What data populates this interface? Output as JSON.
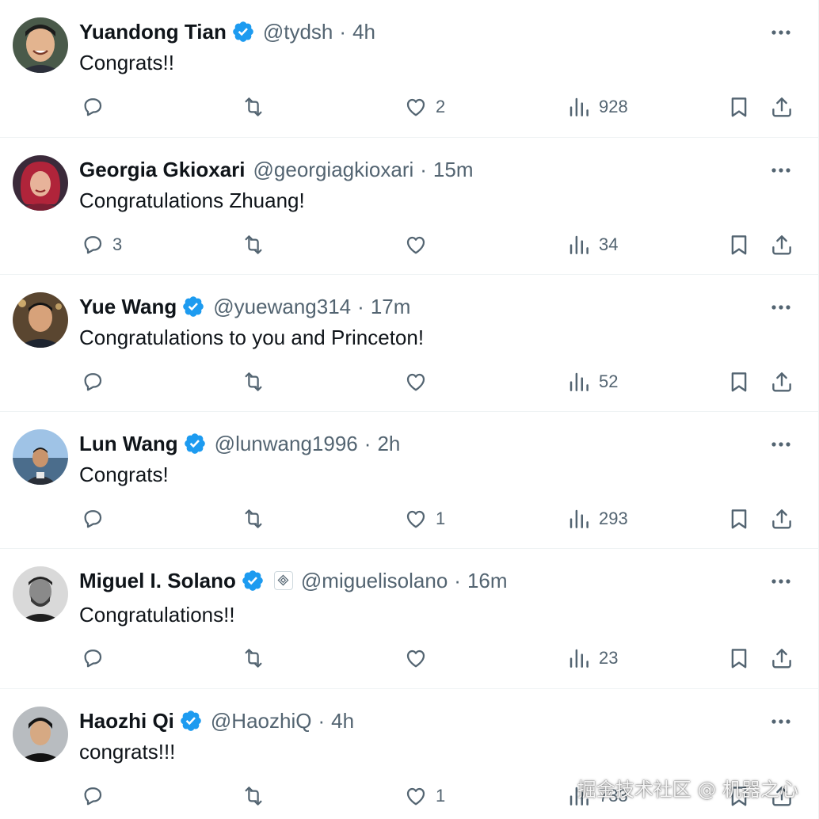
{
  "colors": {
    "text_primary": "#0f1419",
    "text_secondary": "#536471",
    "verified_blue": "#1d9bf0",
    "divider": "#eff3f4"
  },
  "icons": {
    "verified": "verified-badge-icon",
    "more": "more-dots-icon",
    "reply": "reply-bubble-icon",
    "repost": "repost-arrows-icon",
    "like": "heart-icon",
    "views": "bar-chart-icon",
    "bookmark": "bookmark-icon",
    "share": "share-upload-icon"
  },
  "separator": "·",
  "replies": [
    {
      "name": "Yuandong Tian",
      "verified": true,
      "affiliate_badge": false,
      "handle": "@tydsh",
      "time": "4h",
      "text": "Congrats!!",
      "reply_count": "",
      "repost_count": "",
      "like_count": "2",
      "view_count": "928"
    },
    {
      "name": "Georgia Gkioxari",
      "verified": false,
      "affiliate_badge": false,
      "handle": "@georgiagkioxari",
      "time": "15m",
      "text": "Congratulations Zhuang!",
      "reply_count": "3",
      "repost_count": "",
      "like_count": "",
      "view_count": "34"
    },
    {
      "name": "Yue Wang",
      "verified": true,
      "affiliate_badge": false,
      "handle": "@yuewang314",
      "time": "17m",
      "text": "Congratulations to you and Princeton!",
      "reply_count": "",
      "repost_count": "",
      "like_count": "",
      "view_count": "52"
    },
    {
      "name": "Lun Wang",
      "verified": true,
      "affiliate_badge": false,
      "handle": "@lunwang1996",
      "time": "2h",
      "text": "Congrats!",
      "reply_count": "",
      "repost_count": "",
      "like_count": "1",
      "view_count": "293"
    },
    {
      "name": "Miguel I. Solano",
      "verified": true,
      "affiliate_badge": true,
      "handle": "@miguelisolano",
      "time": "16m",
      "text": "Congratulations!!",
      "reply_count": "",
      "repost_count": "",
      "like_count": "",
      "view_count": "23"
    },
    {
      "name": "Haozhi Qi",
      "verified": true,
      "affiliate_badge": false,
      "handle": "@HaozhiQ",
      "time": "4h",
      "text": "congrats!!!",
      "reply_count": "",
      "repost_count": "",
      "like_count": "1",
      "view_count": "733"
    }
  ],
  "watermark": "掘金技术社区 @ 机器之心"
}
